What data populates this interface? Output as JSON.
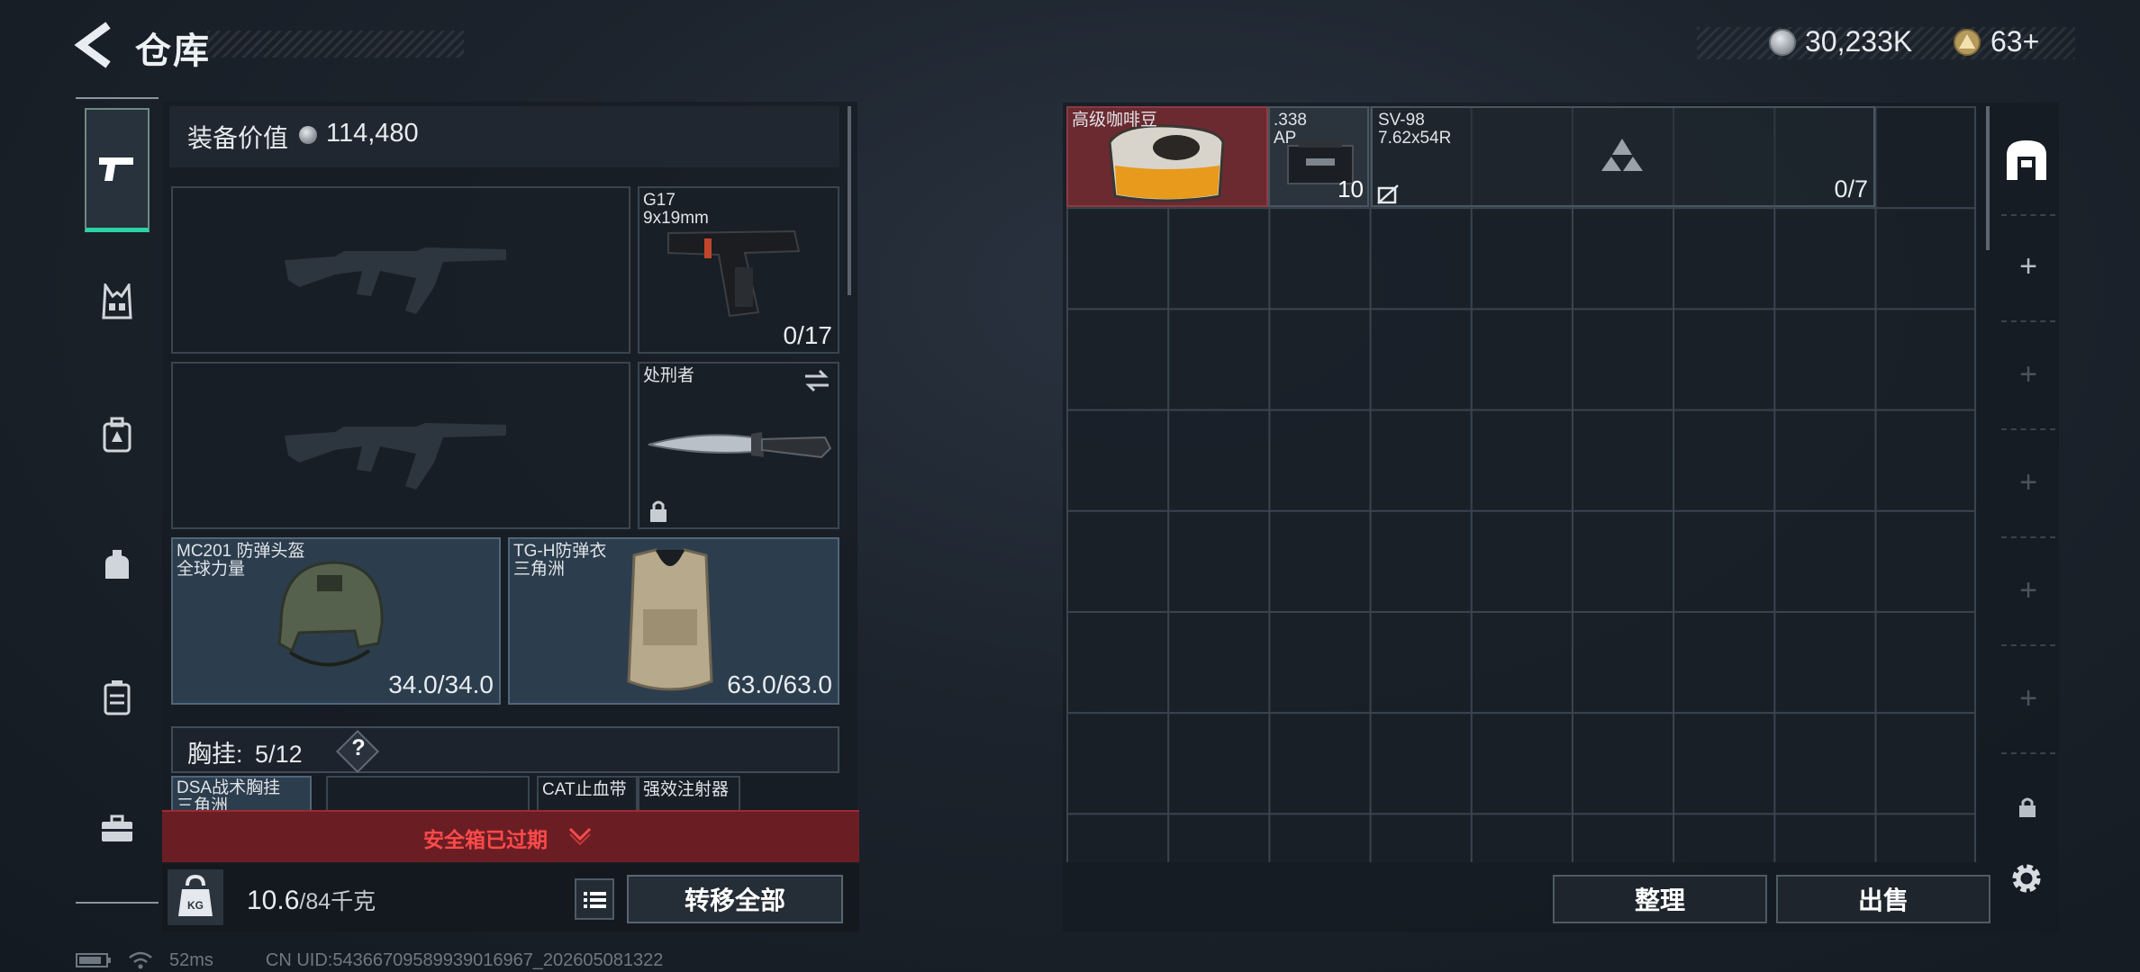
{
  "header": {
    "title": "仓库",
    "currency_1": "30,233K",
    "currency_2": "63+"
  },
  "equipment": {
    "value_label": "装备价值",
    "value": "114,480",
    "pistol": {
      "name": "G17",
      "caliber": "9x19mm",
      "ammo": "0/17"
    },
    "melee": {
      "name": "处刑者"
    },
    "helmet": {
      "name": "MC201 防弹头盔",
      "brand": "全球力量",
      "durability": "34.0/34.0"
    },
    "armor": {
      "name": "TG-H防弹衣",
      "brand": "三角洲",
      "durability": "63.0/63.0"
    },
    "rig": {
      "label": "胸挂:",
      "used": "5",
      "capacity": "/12",
      "help": "?"
    },
    "rig_items": [
      {
        "name": "DSA战术胸挂",
        "brand": "三角洲"
      },
      {
        "name": "CAT止血带"
      },
      {
        "name": "强效注射器"
      }
    ]
  },
  "safebox": {
    "text": "安全箱已过期"
  },
  "bottom": {
    "weight": "10.6",
    "weight_max": "/84千克",
    "transfer_all": "转移全部"
  },
  "storage": {
    "coffee": {
      "name": "高级咖啡豆"
    },
    "ammo": {
      "caliber": ".338",
      "type": "AP",
      "count": "10"
    },
    "sv98": {
      "name": "SV-98",
      "caliber": "7.62x54R",
      "ammo": "0/7"
    },
    "sort_label": "整理",
    "sell_label": "出售"
  },
  "status": {
    "ping": "52ms",
    "uid": "CN UID:54366709589939016967_202605081322"
  },
  "colors": {
    "accent": "#29d3a6",
    "alert": "#ff4a4a",
    "alert_bg": "#6a1e24",
    "coffee_bg": "#6b2a30"
  }
}
